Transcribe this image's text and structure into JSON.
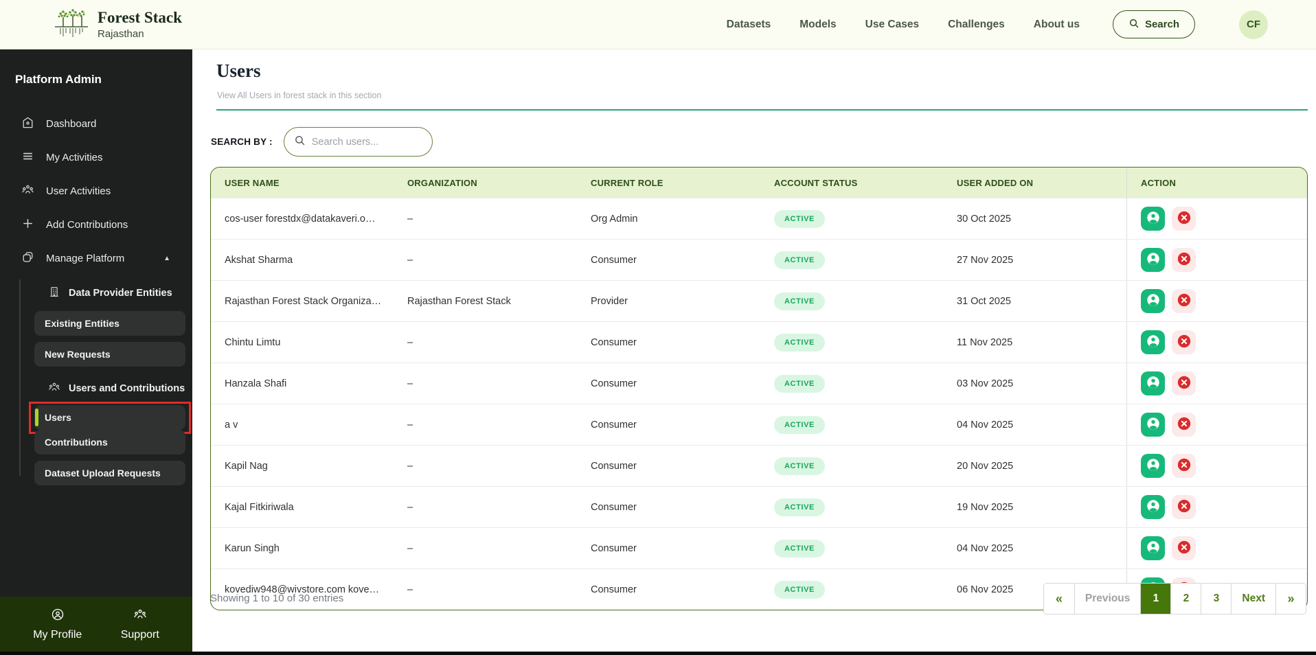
{
  "brand": {
    "title": "Forest Stack",
    "subtitle": "Rajasthan"
  },
  "topnav": {
    "items": [
      "Datasets",
      "Models",
      "Use Cases",
      "Challenges",
      "About us"
    ],
    "search_label": "Search",
    "avatar_initials": "CF"
  },
  "sidebar": {
    "heading": "Platform Admin",
    "items": [
      {
        "label": "Dashboard",
        "icon": "home-icon"
      },
      {
        "label": "My Activities",
        "icon": "menu-icon"
      },
      {
        "label": "User Activities",
        "icon": "people-icon"
      },
      {
        "label": "Add Contributions",
        "icon": "plus-icon"
      },
      {
        "label": "Manage Platform",
        "icon": "box-icon",
        "expanded": true
      }
    ],
    "submenu": {
      "groups": [
        {
          "label": "Data Provider Entities",
          "icon": "building-icon",
          "pills": [
            "Existing Entities",
            "New Requests"
          ]
        },
        {
          "label": "Users and Contributions",
          "icon": "people-icon",
          "pills": [
            "Users",
            "Contributions",
            "Dataset Upload Requests"
          ],
          "active_pill": "Users"
        }
      ]
    },
    "footer": {
      "items": [
        {
          "label": "My Profile",
          "icon": "person-circle-icon"
        },
        {
          "label": "Support",
          "icon": "people-icon"
        }
      ]
    }
  },
  "page": {
    "title": "Users",
    "subtitle": "View All Users in forest stack in this section",
    "search_by_label": "SEARCH BY :",
    "search_placeholder": "Search users..."
  },
  "table": {
    "columns": [
      "USER NAME",
      "ORGANIZATION",
      "CURRENT ROLE",
      "ACCOUNT STATUS",
      "USER ADDED ON",
      "ACTION"
    ],
    "rows": [
      {
        "name": "cos-user forestdx@datakaveri.o…",
        "org": "–",
        "role": "Org Admin",
        "status": "ACTIVE",
        "added": "30 Oct 2025"
      },
      {
        "name": "Akshat Sharma",
        "org": "–",
        "role": "Consumer",
        "status": "ACTIVE",
        "added": "27 Nov 2025"
      },
      {
        "name": "Rajasthan Forest Stack Organiza…",
        "org": "Rajasthan Forest Stack",
        "role": "Provider",
        "status": "ACTIVE",
        "added": "31 Oct 2025"
      },
      {
        "name": "Chintu Limtu",
        "org": "–",
        "role": "Consumer",
        "status": "ACTIVE",
        "added": "11 Nov 2025"
      },
      {
        "name": "Hanzala Shafi",
        "org": "–",
        "role": "Consumer",
        "status": "ACTIVE",
        "added": "03 Nov 2025"
      },
      {
        "name": "a v",
        "org": "–",
        "role": "Consumer",
        "status": "ACTIVE",
        "added": "04 Nov 2025"
      },
      {
        "name": "Kapil Nag",
        "org": "–",
        "role": "Consumer",
        "status": "ACTIVE",
        "added": "20 Nov 2025"
      },
      {
        "name": "Kajal Fitkiriwala",
        "org": "–",
        "role": "Consumer",
        "status": "ACTIVE",
        "added": "19 Nov 2025"
      },
      {
        "name": "Karun Singh",
        "org": "–",
        "role": "Consumer",
        "status": "ACTIVE",
        "added": "04 Nov 2025"
      },
      {
        "name": "kovediw948@wivstore.com kove…",
        "org": "–",
        "role": "Consumer",
        "status": "ACTIVE",
        "added": "06 Nov 2025"
      }
    ],
    "status_colors": {
      "active_bg": "#d9f6e2",
      "active_text": "#17a65a"
    },
    "action_icons": [
      "user-profile-icon",
      "delete-user-icon"
    ]
  },
  "footer": {
    "showing": "Showing 1 to 10 of 30 entries",
    "pagination": {
      "first": "«",
      "prev": "Previous",
      "pages": [
        "1",
        "2",
        "3"
      ],
      "active_page": "1",
      "next": "Next",
      "last": "»"
    }
  },
  "colors": {
    "accent_green": "#2ba17e",
    "table_border": "#4a6b1d",
    "header_bg": "#e7f2d1",
    "sidebar_bg": "#1e201f",
    "sidebar_footer_bg": "#1f3308",
    "lime_accent": "#a6d629",
    "annotation_red": "#e02b2b",
    "action_green": "#16b979",
    "action_red": "#da2c2c"
  }
}
